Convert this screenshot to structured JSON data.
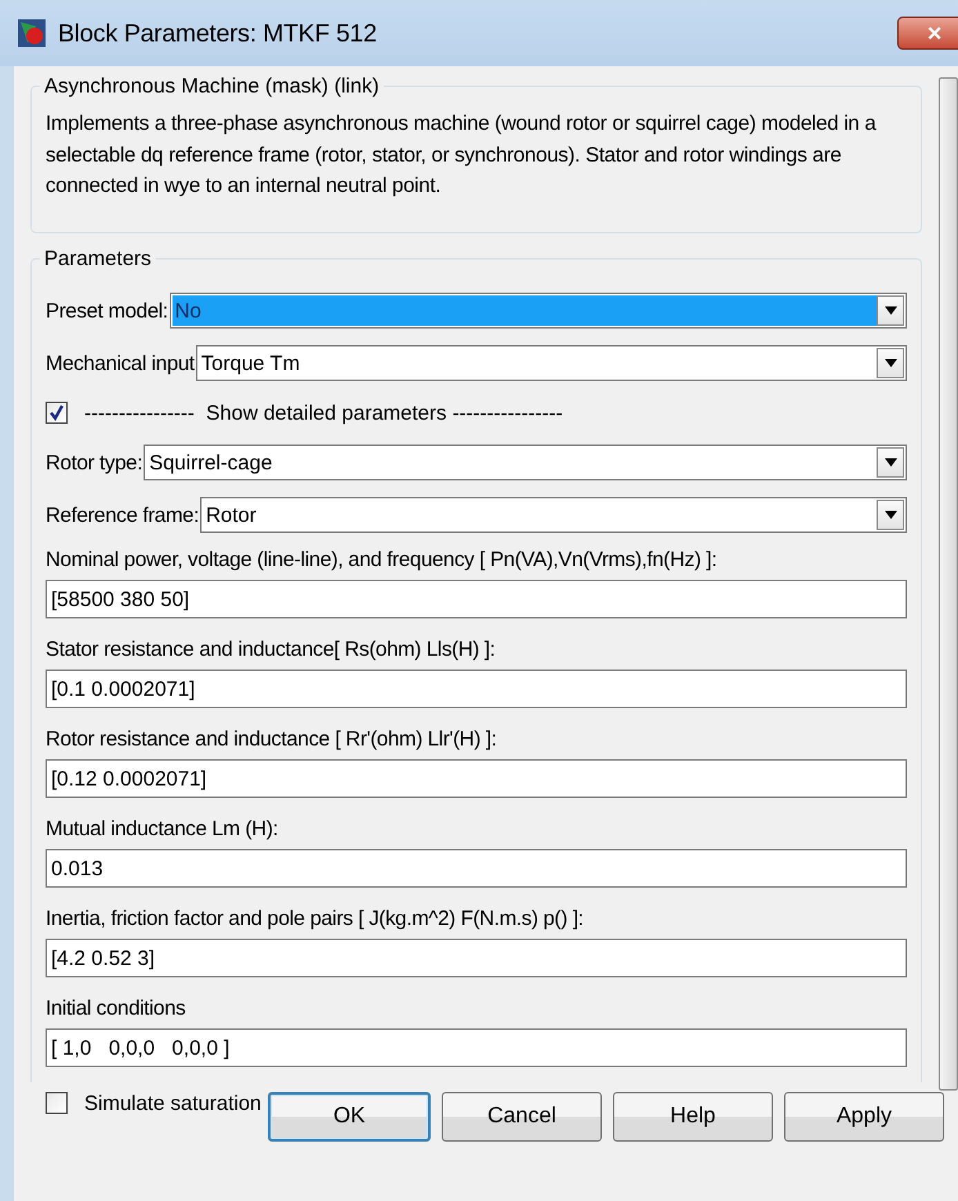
{
  "window": {
    "title": "Block Parameters: MTKF 512",
    "close_label": "×"
  },
  "description_group": {
    "title": "Asynchronous Machine (mask) (link)",
    "text": "Implements a three-phase asynchronous machine (wound rotor or squirrel cage) modeled in a selectable  dq reference frame (rotor, stator, or synchronous). Stator and rotor windings are connected in wye to an internal neutral point."
  },
  "parameters_group": {
    "title": "Parameters",
    "items": [
      {
        "kind": "dropdown",
        "label": "Preset model:",
        "value": "No",
        "focused": true
      },
      {
        "kind": "dropdown",
        "label": "Mechanical input",
        "value": "Torque Tm",
        "focused": false
      },
      {
        "kind": "checkbox",
        "label": "----------------  Show detailed parameters ----------------",
        "checked": true
      },
      {
        "kind": "dropdown",
        "label": "Rotor type:",
        "value": "Squirrel-cage",
        "focused": false
      },
      {
        "kind": "dropdown",
        "label": "Reference frame:",
        "value": "Rotor",
        "focused": false
      },
      {
        "kind": "edit",
        "label": "Nominal power, voltage (line-line), and frequency [ Pn(VA),Vn(Vrms),fn(Hz) ]:",
        "value": "[58500 380 50]"
      },
      {
        "kind": "edit",
        "label": "Stator resistance and inductance[ Rs(ohm)  Lls(H) ]:",
        "value": "[0.1 0.0002071]"
      },
      {
        "kind": "edit",
        "label": "Rotor resistance and inductance [ Rr'(ohm)  Llr'(H) ]:",
        "value": "[0.12 0.0002071]"
      },
      {
        "kind": "edit",
        "label": "Mutual inductance Lm (H):",
        "value": "0.013"
      },
      {
        "kind": "edit",
        "label": "Inertia, friction factor and pole pairs [ J(kg.m^2)  F(N.m.s)  p() ]:",
        "value": "[4.2 0.52 3]"
      },
      {
        "kind": "edit",
        "label": "Initial conditions",
        "value": "[ 1,0   0,0,0   0,0,0 ]"
      },
      {
        "kind": "checkbox",
        "label": "Simulate saturation",
        "checked": false
      }
    ]
  },
  "buttons": [
    {
      "label": "OK",
      "default": true
    },
    {
      "label": "Cancel",
      "default": false
    },
    {
      "label": "Help",
      "default": false
    },
    {
      "label": "Apply",
      "default": false
    }
  ]
}
